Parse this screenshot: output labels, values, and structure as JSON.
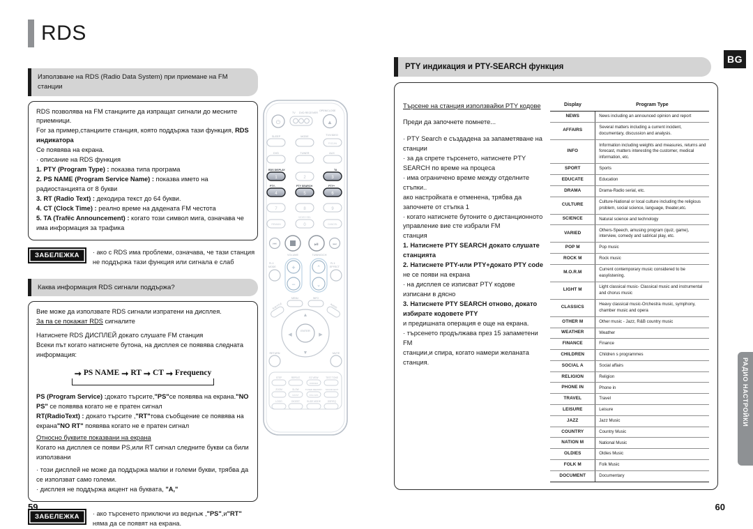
{
  "document": {
    "left_page_number": "59",
    "right_page_number": "60",
    "language_badge": "BG",
    "side_tab_label": "РАДИО НАСТРОЙКИ"
  },
  "left_page": {
    "title": "RDS",
    "section1_heading": "Използване на  RDS (Radio Data System) при приемане на FM станции",
    "section1_body": {
      "line1": "RDS позволява на  FM станциите да изпращат сигнали до месните приемници.",
      "line2": "For за пример,станциите станция, която поддържа тази функция, ",
      "line2_bold": "RDS индикатора",
      "line3": "Се появява на екрана.",
      "line4": "· описание на  RDS функция",
      "item1_label": "1. PTY (Program Type) :",
      "item1_text": " показва типа програма",
      "item2_label": "2. PS NAME (Program Service Name) :",
      "item2_text": " показва името на радиостанцията от 8 букви",
      "item3_label": "3. RT (Radio Text) :",
      "item3_text": " декодира текст до 64 букви.",
      "item4_label": "4. CT (Clock Time) :",
      "item4_text": " реално време на дадената  FM честота",
      "item5_label": "5. TA (Trafёc Announcement) :",
      "item5_text": " когато този символ мига, означава че има информация за трафика"
    },
    "note1": {
      "badge": "ЗАБЕЛЕЖКА",
      "text": "· ако с RDS има проблеми, означава, че тази станция не поддържа тази функция или сигнала е слаб"
    },
    "section2_heading": "Каква информация RDS сигнали поддържа?",
    "section2_body": {
      "line1": "Вие може да използвате RDS сигнали изпратени на дисплея.",
      "line2_underlined": "За па се покажат RDS",
      "line2_rest": " сигналите",
      "line3": "Натиснете  RDS ДИСПЛЕЙ докато слушате  FM станция",
      "line4": "Всеки път когато натиснете  бутона, на дисплея се появява следната информация:",
      "flow": [
        "PS NAME",
        "RT",
        "CT",
        "Frequency"
      ],
      "ps_label": "PS (Program Service) :",
      "ps_text_a": "докато търсите,",
      "ps_quote1": "\"PS\"",
      "ps_text_b": "се появява на екрана.",
      "ps_quote2": "\"NO PS\"",
      "ps_text_c": " се появява когато не е пратен сигнал",
      "rt_label": "RT(RadioText) :",
      "rt_text_a": " докато търсите ,",
      "rt_quote1": "\"RT\"",
      "rt_text_b": "това съобщение се появява на екрана",
      "rt_quote2": "\"NO RT\"",
      "rt_text_c": " появява когато не е пратен сигнал",
      "about_letters_underlined": "Относно буквите показвани на екрана",
      "line5": "Когато на дисплея се появи PS,или RT сигнал следните букви са били използвани",
      "bullet1": "· този дисплей не може да поддържа малки и големи букви, трябва да се използват само големи.",
      "bullet2_a": "· дисплея не поддържа акцент на буквата, ",
      "bullet2_quote": "\"A,\""
    },
    "note2": {
      "badge": "ЗАБЕЛЕЖКА",
      "text_a": "· ако търсенето приключи из веднъж ,",
      "quote1": "\"PS\"",
      "text_b": ",и",
      "quote2": "\"RT\"",
      "text_c": " няма да се появят на екрана."
    }
  },
  "remote": {
    "name": "remote-control-illustration",
    "top_labels": {
      "power": "",
      "tv": "TV",
      "dvd_recv": "DVD RECEIVER",
      "open_close": "OPEN/CLOSE"
    },
    "rows": [
      {
        "labels": [
          "SLEEP",
          "MODE",
          "TV/VIDEO"
        ],
        "keys": [
          "",
          "",
          "P.SCAN"
        ]
      },
      {
        "labels": [
          "DVD",
          "TUNER",
          "AUX"
        ],
        "keys": [
          "",
          "",
          ""
        ]
      },
      {
        "labels": [
          "RDS DISPLAY",
          "",
          "TA"
        ],
        "keys": [
          "1",
          "2",
          "3"
        ],
        "highlight": [
          true,
          false,
          true
        ]
      },
      {
        "labels": [
          "PTY-",
          "PTY SEARCH",
          "PTY+"
        ],
        "keys": [
          "4",
          "5",
          "6"
        ],
        "highlight": [
          true,
          true,
          true
        ]
      },
      {
        "labels": [
          "",
          "",
          ""
        ],
        "keys": [
          "7",
          "8",
          "9"
        ]
      },
      {
        "labels": [
          "REMAIN",
          "VIDEO SEL",
          "CANCEL"
        ],
        "keys": [
          "",
          "0",
          ""
        ]
      }
    ],
    "transport_labels": {
      "volume": "VOLUME",
      "tuning": "TUNING/CH"
    },
    "mid_labels": {
      "play_mode": "PLAY MODE",
      "effect": "PL II EFFECT",
      "menu": "MENU",
      "info": "INFO",
      "subtitle": "SUBTITLE",
      "audio": "AUDIO",
      "enter": "ENTER",
      "return": "RETURN",
      "mute": "MUTE"
    },
    "bottom_keys": [
      [
        "STEP",
        "REPEAT",
        "EZ VIEW / DIMMER",
        "TEST TONE"
      ],
      [
        "ZOOM",
        "SLOW / MO/ST",
        "TUNER MEMORY / DSC-M/S",
        "SOUND EDIT"
      ],
      [
        "LOGO",
        "DIGEST",
        "SLIDE MODE",
        "DSP/EQ"
      ]
    ]
  },
  "right_page": {
    "heading": "PTY индикация и PTY-SEARCH функция",
    "subheading": "Търсене на станция използвайки PTY кодове",
    "intro": "Преди да започнете помнете...",
    "body": [
      "· PTY Search е създадена за запаметяване на станции",
      "· за да спрете търсенето, натиснете  PTY SEARCH по време на процеса",
      "· има ограничено време между отделните стъпки..",
      "ако настройката е отменена, трябва да започнете от стъпка 1",
      "· когато натиснете бутоните о дистанционното управление вие сте избрали FM",
      "станция",
      "1. Натиснете  PTY SEARCH докато слушате станцията",
      "2. Натиснете PTY-или PTY+докато PTY code",
      "не се появи на екрана",
      "· на дисплея се изписват PTY кодове изписани в дясно",
      "3. Натиснете PTY SEARCH отново, докато избирате кодовете PTY",
      "и предишната операция е още на екрана.",
      "· търсенето продължава през  15 запаметени  FM",
      "станции,и спира, когато намери желаната станция."
    ],
    "table": {
      "col_display": "Display",
      "col_program_type": "Program Type",
      "rows": [
        {
          "display": "NEWS",
          "type": "News including an announced opinion and report"
        },
        {
          "display": "AFFAIRS",
          "type": "Several matters including a current incident, documentary, discussion and analysis."
        },
        {
          "display": "INFO",
          "type": "Information including weights and measures, returns and forecast, matters interesting the customer, medical information, etc."
        },
        {
          "display": "SPORT",
          "type": "Sports"
        },
        {
          "display": "EDUCATE",
          "type": "Education"
        },
        {
          "display": "DRAMA",
          "type": "Drama-Radio serial, etc."
        },
        {
          "display": "CULTURE",
          "type": "Culture-National or local culture including the religious problem, social science, language, theater,etc."
        },
        {
          "display": "SCIENCE",
          "type": "Natural science and technology"
        },
        {
          "display": "VARIED",
          "type": "Others-Speech, amusing program (quiz, game), interview, comedy and satirical play, etc."
        },
        {
          "display": "POP M",
          "type": "Pop music"
        },
        {
          "display": "ROCK M",
          "type": "Rock music"
        },
        {
          "display": "M.O.R.M",
          "type": "Current contemporary music considered to be  easylistening."
        },
        {
          "display": "LIGHT M",
          "type": "Light classical music- Classical music and instrumental and chorus music"
        },
        {
          "display": "CLASSICS",
          "type": "Heavy classical  music-Orchestra music, symphony, chamber music and opera"
        },
        {
          "display": "OTHER M",
          "type": "Other music - Jazz, R&B country music"
        },
        {
          "display": "WEATHER",
          "type": "Weather"
        },
        {
          "display": "FINANCE",
          "type": "Finance"
        },
        {
          "display": "CHILDREN",
          "type": "Children s programmes"
        },
        {
          "display": "SOCIAL A",
          "type": "Social affairs"
        },
        {
          "display": "RELIGION",
          "type": "Religion"
        },
        {
          "display": "PHONE IN",
          "type": "Phone in"
        },
        {
          "display": "TRAVEL",
          "type": "Travel"
        },
        {
          "display": "LEISURE",
          "type": "Leisure"
        },
        {
          "display": "JAZZ",
          "type": "Jazz Music"
        },
        {
          "display": "COUNTRY",
          "type": "Country Music"
        },
        {
          "display": "NATION M",
          "type": "National Music"
        },
        {
          "display": "OLDIES",
          "type": "Oldies Music"
        },
        {
          "display": "FOLK M",
          "type": "Folk Music"
        },
        {
          "display": "DOCUMENT",
          "type": "Documentary"
        }
      ]
    }
  }
}
